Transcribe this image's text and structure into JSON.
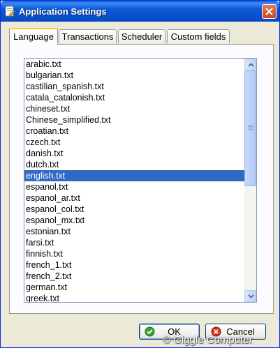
{
  "window": {
    "title": "Application Settings"
  },
  "tabs": [
    {
      "label": "Language"
    },
    {
      "label": "Transactions"
    },
    {
      "label": "Scheduler"
    },
    {
      "label": "Custom fields"
    }
  ],
  "list": {
    "selected": "english.txt",
    "items": [
      "arabic.txt",
      "bulgarian.txt",
      "castilian_spanish.txt",
      "catala_catalonish.txt",
      "chineset.txt",
      "Chinese_simplified.txt",
      "croatian.txt",
      "czech.txt",
      "danish.txt",
      "dutch.txt",
      "english.txt",
      "espanol.txt",
      "espanol_ar.txt",
      "espanol_col.txt",
      "espanol_mx.txt",
      "estonian.txt",
      "farsi.txt",
      "finnish.txt",
      "french_1.txt",
      "french_2.txt",
      "german.txt",
      "greek.txt"
    ]
  },
  "buttons": {
    "ok": "OK",
    "cancel": "Cancel"
  },
  "watermark": "© Giggle Computer",
  "colors": {
    "selection": "#316ac5",
    "titlebar": "#0a50cc",
    "ok_icon": "#3aa13a",
    "cancel_icon": "#d8321e"
  }
}
